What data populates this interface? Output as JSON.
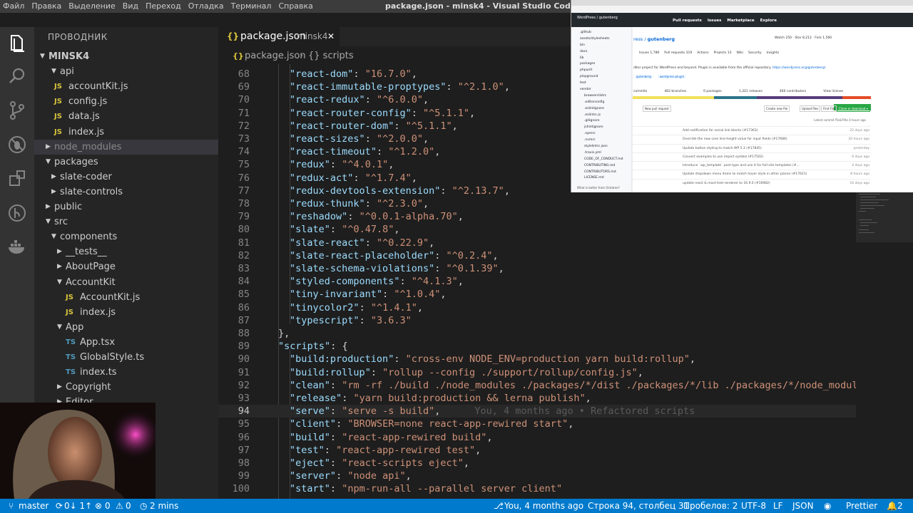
{
  "window": {
    "title": "package.json - minsk4 - Visual Studio Code",
    "menu": [
      "Файл",
      "Правка",
      "Выделение",
      "Вид",
      "Переход",
      "Отладка",
      "Терминал",
      "Справка"
    ]
  },
  "sidebar": {
    "title": "ПРОВОДНИК",
    "tree": [
      {
        "label": "MINSK4",
        "type": "root"
      },
      {
        "label": "api",
        "type": "folder-open"
      },
      {
        "label": "accountKit.js",
        "type": "js"
      },
      {
        "label": "config.js",
        "type": "js"
      },
      {
        "label": "data.js",
        "type": "js"
      },
      {
        "label": "index.js",
        "type": "js"
      },
      {
        "label": "node_modules",
        "type": "folder-closed"
      },
      {
        "label": "packages",
        "type": "folder-open"
      },
      {
        "label": "slate-coder",
        "type": "folder-closed"
      },
      {
        "label": "slate-controls",
        "type": "folder-closed"
      },
      {
        "label": "public",
        "type": "folder-closed"
      },
      {
        "label": "src",
        "type": "folder-open"
      },
      {
        "label": "components",
        "type": "folder-open"
      },
      {
        "label": "__tests__",
        "type": "folder-closed"
      },
      {
        "label": "AboutPage",
        "type": "folder-closed"
      },
      {
        "label": "AccountKit",
        "type": "folder-open"
      },
      {
        "label": "AccountKit.js",
        "type": "js"
      },
      {
        "label": "index.js",
        "type": "js"
      },
      {
        "label": "App",
        "type": "folder-open"
      },
      {
        "label": "App.tsx",
        "type": "ts"
      },
      {
        "label": "GlobalStyle.ts",
        "type": "ts"
      },
      {
        "label": "index.ts",
        "type": "ts"
      },
      {
        "label": "Copyright",
        "type": "folder-closed"
      },
      {
        "label": "Editor",
        "type": "folder-closed"
      }
    ]
  },
  "tab": {
    "name": "package.json",
    "folder": "minsk4",
    "close": "✕"
  },
  "breadcrumb": {
    "file": "package.json",
    "section": "{} scripts"
  },
  "code": [
    {
      "n": "68",
      "key": "react-dom",
      "val": "16.7.0"
    },
    {
      "n": "69",
      "key": "react-immutable-proptypes",
      "val": "^2.1.0"
    },
    {
      "n": "70",
      "key": "react-redux",
      "val": "^6.0.0"
    },
    {
      "n": "71",
      "key": "react-router-config",
      "val": "^5.1.1"
    },
    {
      "n": "72",
      "key": "react-router-dom",
      "val": "^5.1.1"
    },
    {
      "n": "73",
      "key": "react-sizes",
      "val": "^2.0.0"
    },
    {
      "n": "74",
      "key": "react-timeout",
      "val": "^1.2.0"
    },
    {
      "n": "75",
      "key": "redux",
      "val": "^4.0.1"
    },
    {
      "n": "76",
      "key": "redux-act",
      "val": "^1.7.4"
    },
    {
      "n": "77",
      "key": "redux-devtools-extension",
      "val": "^2.13.7"
    },
    {
      "n": "78",
      "key": "redux-thunk",
      "val": "^2.3.0"
    },
    {
      "n": "79",
      "key": "reshadow",
      "val": "^0.0.1-alpha.70"
    },
    {
      "n": "80",
      "key": "slate",
      "val": "^0.47.8"
    },
    {
      "n": "81",
      "key": "slate-react",
      "val": "^0.22.9"
    },
    {
      "n": "82",
      "key": "slate-react-placeholder",
      "val": "^0.2.4"
    },
    {
      "n": "83",
      "key": "slate-schema-violations",
      "val": "^0.1.39"
    },
    {
      "n": "84",
      "key": "styled-components",
      "val": "^4.1.3"
    },
    {
      "n": "85",
      "key": "tiny-invariant",
      "val": "^1.0.4"
    },
    {
      "n": "86",
      "key": "tinycolor2",
      "val": "^1.4.1"
    },
    {
      "n": "87",
      "key": "typescript",
      "val": "3.6.3",
      "last": true
    },
    {
      "n": "88",
      "raw": "},"
    },
    {
      "n": "89",
      "key": "scripts",
      "open": true
    },
    {
      "n": "90",
      "key": "build:production",
      "val": "cross-env NODE_ENV=production yarn build:rollup"
    },
    {
      "n": "91",
      "key": "build:rollup",
      "val": "rollup --config ./support/rollup/config.js"
    },
    {
      "n": "92",
      "key": "clean",
      "val": "rm -rf ./build ./node_modules ./packages/*/dist ./packages/*/lib ./packages/*/node_module"
    },
    {
      "n": "93",
      "key": "release",
      "val": "yarn build:production && lerna publish"
    },
    {
      "n": "94",
      "key": "serve",
      "val": "serve -s build",
      "blame": "You, 4 months ago • Refactored scripts"
    },
    {
      "n": "95",
      "key": "client",
      "val": "BROWSER=none react-app-rewired start"
    },
    {
      "n": "96",
      "key": "build",
      "val": "react-app-rewired build"
    },
    {
      "n": "97",
      "key": "test",
      "val": "react-app-rewired test"
    },
    {
      "n": "98",
      "key": "eject",
      "val": "react-scripts eject"
    },
    {
      "n": "99",
      "key": "server",
      "val": "node api"
    },
    {
      "n": "100",
      "key": "start",
      "val": "npm-run-all --parallel server client"
    }
  ],
  "browser": {
    "repo_owner": "WordPress / gutenberg",
    "nav": [
      "Pull requests",
      "Issues",
      "Marketplace",
      "Explore"
    ],
    "repo_name": "gutenberg",
    "watch": "Watch",
    "watch_count": "250",
    "star": "Star",
    "star_count": "8,212",
    "fork": "Fork",
    "fork_count": "1,560",
    "tabs": [
      "Issues 1,789",
      "Pull requests 319",
      "Actions",
      "Projects 13",
      "Wiki",
      "Security",
      "Insights"
    ],
    "description": "ditor project for WordPress and beyond. Plugin is available from the official repository.",
    "link": "https://wordpress.org/gutenberg/",
    "topics": [
      "gutenberg",
      "wordpress-plugin"
    ],
    "stats": [
      "commits",
      "462 branches",
      "0 packages",
      "1,321 releases",
      "460 contributors",
      "View license"
    ],
    "buttons": [
      "New pull request",
      "Create new file",
      "Upload files",
      "Find File",
      "Clone or download ▾"
    ],
    "latest": "Latest commit f5eb7f4e 4 hours ago",
    "commits": [
      {
        "msg": "Add notification for social link blocks (#17363)",
        "time": "22 days ago"
      },
      {
        "msg": "Override the new core line-height value for input fields (#17686)",
        "time": "20 hours ago"
      },
      {
        "msg": "Update button styling to match WP 5.3 (#17845)",
        "time": "yesterday"
      },
      {
        "msg": "Convert examples to use import symbol (#17502)",
        "time": "6 days ago"
      },
      {
        "msg": "Introduce `wp_template` post type and use it for full-site templates (#...",
        "time": "4 days ago"
      },
      {
        "msg": "Update dropdown menu items to match hover style in other places (#17621)",
        "time": "8 hours ago"
      },
      {
        "msg": "update react & react-test-renderer to 16.9.0 (#16982)",
        "time": "16 days ago"
      }
    ],
    "files": [
      ".github",
      "assets/stylesheets",
      "bin",
      "docs",
      "lib",
      "packages",
      "phpunit",
      "playground",
      "test",
      "vendor",
      "browserslistrc",
      ".editorconfig",
      ".eslintignore",
      ".eslintrc.js",
      ".gitignore",
      "jshintignore",
      ".npmrc",
      ".nvmrc",
      "stylelintrc.json",
      ".travis.yml",
      "CODE_OF_CONDUCT.md",
      "CONTRIBUTING.md",
      "CONTRIBUTORS.md",
      "LICENSE.md"
    ],
    "footer": "What is better from Octotree?"
  },
  "statusbar": {
    "branch": "master",
    "sync": "0↓ 1↑",
    "errors": "0",
    "warnings": "0",
    "time": "2 mins",
    "blame": "You, 4 months ago",
    "position": "Строка 94, столбец 31",
    "spaces": "Пробелов: 2",
    "encoding": "UTF-8",
    "eol": "LF",
    "language": "JSON",
    "formatter": "Prettier",
    "notifications": "2"
  }
}
